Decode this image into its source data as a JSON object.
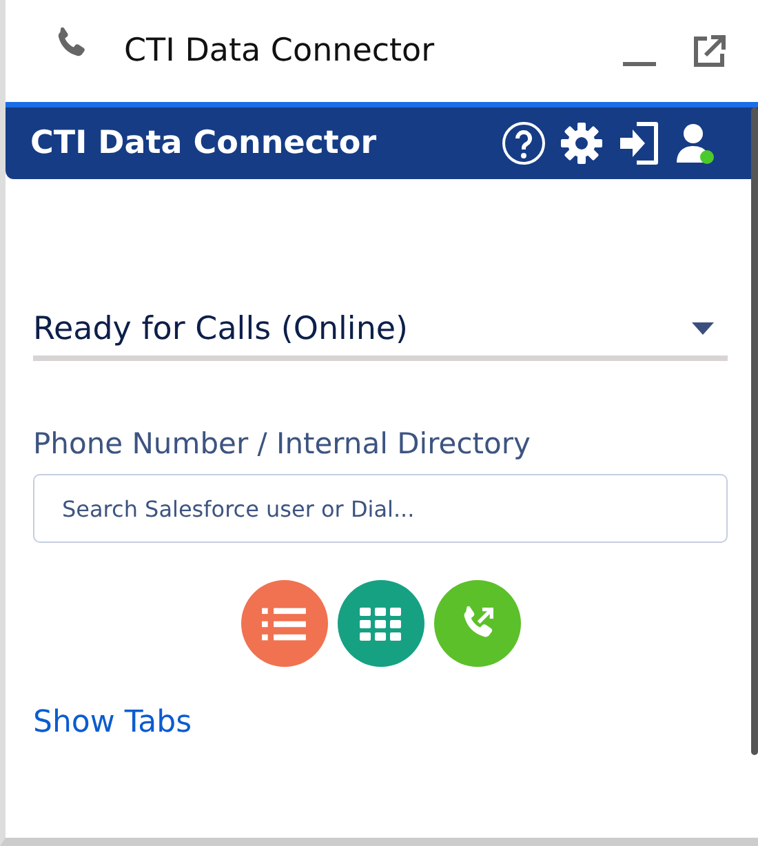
{
  "utility_bar": {
    "title": "CTI Data Connector"
  },
  "header": {
    "title": "CTI Data Connector"
  },
  "status_select": {
    "value": "Ready for Calls (Online)"
  },
  "dial": {
    "label": "Phone Number / Internal Directory",
    "placeholder": "Search Salesforce user or Dial..."
  },
  "actions": [
    {
      "kind": "list"
    },
    {
      "kind": "keypad"
    },
    {
      "kind": "call"
    }
  ],
  "show_tabs_link": "Show Tabs"
}
